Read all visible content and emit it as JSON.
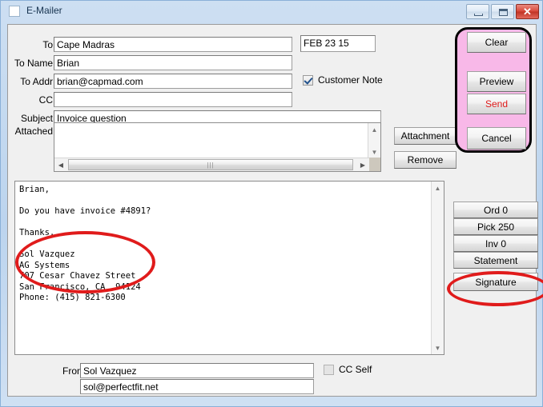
{
  "window": {
    "title": "E-Mailer",
    "icon": "app-square-icon",
    "controls": {
      "minimize": "—",
      "maximize": "□",
      "close": "✕"
    }
  },
  "form": {
    "fields": [
      {
        "label": "To",
        "value": "Cape Madras",
        "placeholder": ""
      },
      {
        "label": "To Name",
        "value": "Brian",
        "placeholder": ""
      },
      {
        "label": "To Addr",
        "value": "brian@capmad.com",
        "placeholder": ""
      },
      {
        "label": "CC",
        "value": "",
        "placeholder": ""
      },
      {
        "label": "Subject",
        "value": "Invoice question",
        "placeholder": ""
      },
      {
        "label": "Attached",
        "value": "",
        "placeholder": ""
      }
    ],
    "date": {
      "value": "FEB 23 15",
      "placeholder": ""
    },
    "customer_note": {
      "label": "Customer Note",
      "checked": true
    },
    "from": {
      "label": "From",
      "name_value": "Sol Vazquez",
      "email_value": "sol@perfectfit.net",
      "name_placeholder": "",
      "email_placeholder": ""
    },
    "cc_self": {
      "label": "CC Self",
      "checked": false
    }
  },
  "body": {
    "text": "Brian,\n\nDo you have invoice #4891?\n\nThanks,\n\nSol Vazquez\nAG Systems\n707 Cesar Chavez Street\nSan Francisco, CA  94124\nPhone: (415) 821-6300"
  },
  "attachment_buttons": {
    "attachment": "Attachment",
    "remove": "Remove"
  },
  "action_panel": {
    "clear": "Clear",
    "preview": "Preview",
    "send": "Send",
    "cancel": "Cancel",
    "highlight_color": "#f8b8e8",
    "send_color": "#e01b1b"
  },
  "side_buttons": [
    {
      "label": "Ord 0"
    },
    {
      "label": "Pick 250"
    },
    {
      "label": "Inv 0"
    },
    {
      "label": "Statement"
    },
    {
      "label": "Signature"
    }
  ],
  "annotations": {
    "color": "#e01b1b",
    "signature_block": "signature-block-ellipse",
    "signature_button": "signature-button-ellipse"
  },
  "scroll": {
    "up_arrow": "▲",
    "down_arrow": "▼",
    "left_arrow": "◀",
    "right_arrow": "▶",
    "grip": "|||"
  }
}
